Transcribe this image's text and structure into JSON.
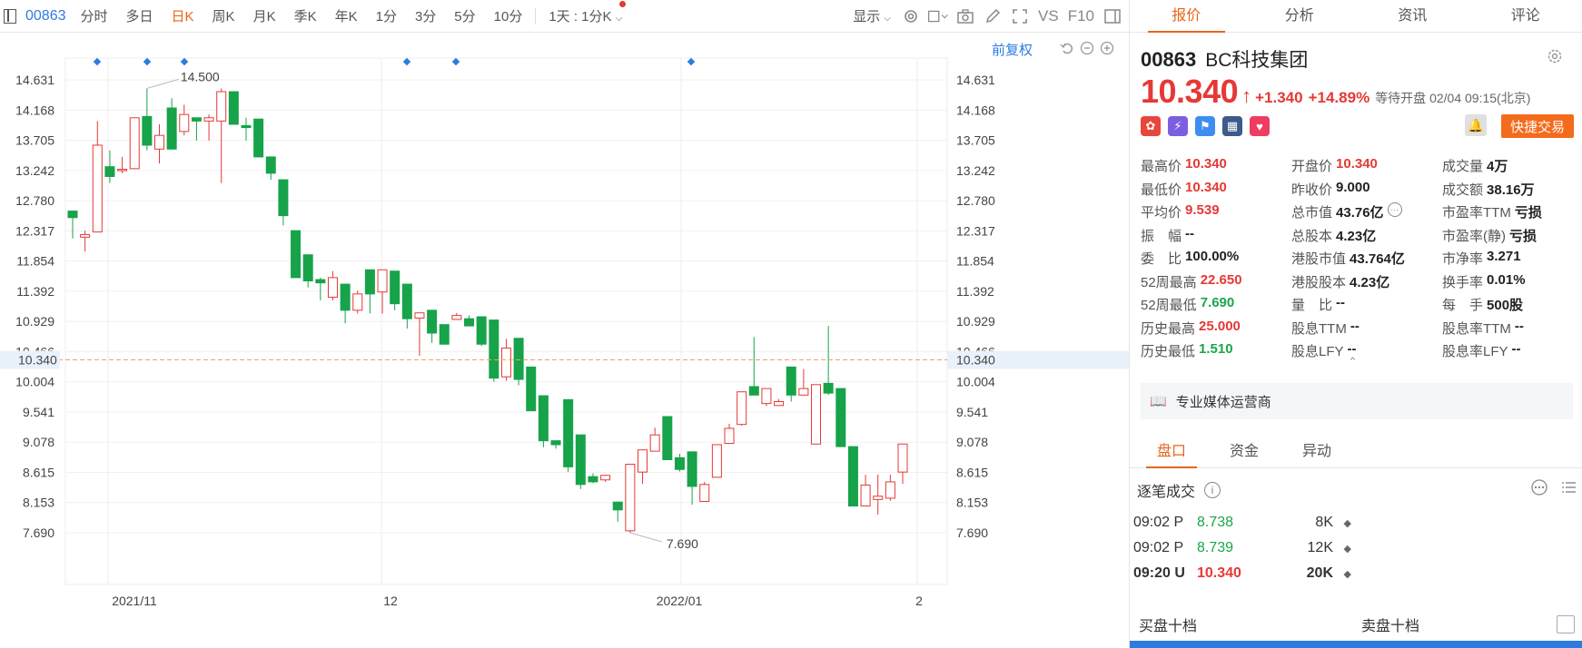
{
  "toolbar": {
    "code": "00863",
    "periods": [
      "分时",
      "多日",
      "日K",
      "周K",
      "月K",
      "季K",
      "年K",
      "1分",
      "3分",
      "5分",
      "10分"
    ],
    "active_period": "日K",
    "multi_period": "1天 : 1分K",
    "display": "显示",
    "vs": "VS",
    "f10": "F10"
  },
  "chart": {
    "adjust": "前复权",
    "high_mark": "14.500",
    "low_mark": "7.690",
    "current_price_label": "10.340",
    "y_ticks": [
      "14.631",
      "14.168",
      "13.705",
      "13.242",
      "12.780",
      "12.317",
      "11.854",
      "11.392",
      "10.929",
      "10.466",
      "10.004",
      "9.541",
      "9.078",
      "8.615",
      "8.153",
      "7.690"
    ],
    "x_labels": [
      "2021/11",
      "12",
      "2022/01",
      "2"
    ]
  },
  "chart_data": {
    "type": "candlestick",
    "ylim": [
      7.69,
      14.631
    ],
    "x": [
      "2021/11",
      "12",
      "2022/01",
      "2"
    ],
    "current_price": 10.34,
    "annotated_high": 14.5,
    "annotated_low": 7.69,
    "candles": [
      {
        "o": 12.62,
        "c": 12.52,
        "h": 12.62,
        "l": 12.2
      },
      {
        "o": 12.22,
        "c": 12.26,
        "h": 12.32,
        "l": 12.0
      },
      {
        "o": 12.3,
        "c": 13.63,
        "h": 14.0,
        "l": 12.3
      },
      {
        "o": 13.3,
        "c": 13.15,
        "h": 13.55,
        "l": 13.05
      },
      {
        "o": 13.26,
        "c": 13.26,
        "h": 13.45,
        "l": 13.2
      },
      {
        "o": 13.27,
        "c": 14.05,
        "h": 14.05,
        "l": 13.27
      },
      {
        "o": 14.07,
        "c": 13.63,
        "h": 14.5,
        "l": 13.55
      },
      {
        "o": 13.57,
        "c": 13.78,
        "h": 13.95,
        "l": 13.35
      },
      {
        "o": 14.2,
        "c": 13.57,
        "h": 14.35,
        "l": 13.57
      },
      {
        "o": 13.84,
        "c": 14.1,
        "h": 14.25,
        "l": 13.78
      },
      {
        "o": 14.05,
        "c": 14.0,
        "h": 14.05,
        "l": 13.7
      },
      {
        "o": 14.0,
        "c": 14.05,
        "h": 14.1,
        "l": 13.7
      },
      {
        "o": 14.0,
        "c": 14.45,
        "h": 14.5,
        "l": 13.05
      },
      {
        "o": 14.45,
        "c": 13.95,
        "h": 14.45,
        "l": 13.95
      },
      {
        "o": 13.93,
        "c": 13.9,
        "h": 14.05,
        "l": 13.7
      },
      {
        "o": 14.03,
        "c": 13.45,
        "h": 14.03,
        "l": 13.45
      },
      {
        "o": 13.45,
        "c": 13.2,
        "h": 13.45,
        "l": 13.1
      },
      {
        "o": 13.1,
        "c": 12.55,
        "h": 13.1,
        "l": 12.4
      },
      {
        "o": 12.32,
        "c": 11.6,
        "h": 12.32,
        "l": 11.6
      },
      {
        "o": 11.95,
        "c": 11.55,
        "h": 11.95,
        "l": 11.45
      },
      {
        "o": 11.57,
        "c": 11.52,
        "h": 11.6,
        "l": 11.25
      },
      {
        "o": 11.3,
        "c": 11.6,
        "h": 11.7,
        "l": 11.25
      },
      {
        "o": 11.5,
        "c": 11.1,
        "h": 11.5,
        "l": 10.9
      },
      {
        "o": 11.1,
        "c": 11.35,
        "h": 11.4,
        "l": 11.05
      },
      {
        "o": 11.72,
        "c": 11.35,
        "h": 11.72,
        "l": 11.05
      },
      {
        "o": 11.38,
        "c": 11.72,
        "h": 11.72,
        "l": 11.05
      },
      {
        "o": 11.7,
        "c": 11.2,
        "h": 11.7,
        "l": 11.1
      },
      {
        "o": 11.5,
        "c": 10.97,
        "h": 11.5,
        "l": 10.82
      },
      {
        "o": 10.98,
        "c": 11.06,
        "h": 11.06,
        "l": 10.4
      },
      {
        "o": 11.1,
        "c": 10.75,
        "h": 11.1,
        "l": 10.6
      },
      {
        "o": 10.88,
        "c": 10.58,
        "h": 10.88,
        "l": 10.58
      },
      {
        "o": 10.96,
        "c": 11.02,
        "h": 11.06,
        "l": 10.96
      },
      {
        "o": 10.97,
        "c": 10.86,
        "h": 11.02,
        "l": 10.86
      },
      {
        "o": 11.0,
        "c": 10.58,
        "h": 11.0,
        "l": 10.55
      },
      {
        "o": 10.95,
        "c": 10.06,
        "h": 10.95,
        "l": 10.0
      },
      {
        "o": 10.08,
        "c": 10.52,
        "h": 10.66,
        "l": 10.02
      },
      {
        "o": 10.67,
        "c": 10.04,
        "h": 10.67,
        "l": 9.95
      },
      {
        "o": 10.23,
        "c": 9.56,
        "h": 10.23,
        "l": 9.56
      },
      {
        "o": 9.79,
        "c": 9.1,
        "h": 9.79,
        "l": 9.0
      },
      {
        "o": 9.1,
        "c": 9.04,
        "h": 9.1,
        "l": 8.98
      },
      {
        "o": 9.73,
        "c": 8.7,
        "h": 9.73,
        "l": 8.62
      },
      {
        "o": 9.19,
        "c": 8.43,
        "h": 9.19,
        "l": 8.36
      },
      {
        "o": 8.55,
        "c": 8.47,
        "h": 8.6,
        "l": 8.45
      },
      {
        "o": 8.5,
        "c": 8.57,
        "h": 8.58,
        "l": 8.47
      },
      {
        "o": 8.16,
        "c": 8.04,
        "h": 8.16,
        "l": 7.86
      },
      {
        "o": 7.72,
        "c": 8.74,
        "h": 8.74,
        "l": 7.69
      },
      {
        "o": 8.62,
        "c": 8.96,
        "h": 8.96,
        "l": 8.44
      },
      {
        "o": 8.94,
        "c": 9.19,
        "h": 9.3,
        "l": 8.94
      },
      {
        "o": 9.47,
        "c": 8.81,
        "h": 9.47,
        "l": 8.81
      },
      {
        "o": 8.84,
        "c": 8.66,
        "h": 8.9,
        "l": 8.63
      },
      {
        "o": 8.93,
        "c": 8.4,
        "h": 8.93,
        "l": 8.12
      },
      {
        "o": 8.17,
        "c": 8.43,
        "h": 8.47,
        "l": 8.17
      },
      {
        "o": 8.54,
        "c": 9.04,
        "h": 9.04,
        "l": 8.54
      },
      {
        "o": 9.06,
        "c": 9.29,
        "h": 9.36,
        "l": 9.06
      },
      {
        "o": 9.35,
        "c": 9.85,
        "h": 9.85,
        "l": 9.33
      },
      {
        "o": 9.93,
        "c": 9.8,
        "h": 10.69,
        "l": 9.8
      },
      {
        "o": 9.67,
        "c": 9.9,
        "h": 9.9,
        "l": 9.63
      },
      {
        "o": 9.64,
        "c": 9.7,
        "h": 9.74,
        "l": 9.64
      },
      {
        "o": 10.23,
        "c": 9.8,
        "h": 10.23,
        "l": 9.7
      },
      {
        "o": 9.8,
        "c": 9.9,
        "h": 10.2,
        "l": 9.8
      },
      {
        "o": 9.05,
        "c": 9.96,
        "h": 9.96,
        "l": 9.05
      },
      {
        "o": 9.98,
        "c": 9.83,
        "h": 10.86,
        "l": 9.8
      },
      {
        "o": 9.9,
        "c": 9.01,
        "h": 9.9,
        "l": 9.01
      },
      {
        "o": 9.01,
        "c": 8.1,
        "h": 9.01,
        "l": 8.1
      },
      {
        "o": 8.1,
        "c": 8.42,
        "h": 8.58,
        "l": 8.1
      },
      {
        "o": 8.2,
        "c": 8.25,
        "h": 8.58,
        "l": 7.97
      },
      {
        "o": 8.22,
        "c": 8.47,
        "h": 8.58,
        "l": 8.18
      },
      {
        "o": 8.62,
        "c": 9.05,
        "h": 9.05,
        "l": 8.44
      }
    ]
  },
  "panel": {
    "tabs": [
      "报价",
      "分析",
      "资讯",
      "评论"
    ],
    "code": "00863",
    "name": "BC科技集团",
    "price": "10.340",
    "change": "+1.340",
    "change_pct": "+14.89%",
    "status": "等待开盘 02/04 09:15(北京)",
    "quick_trade": "快捷交易",
    "quote_rows": [
      [
        {
          "l": "最高价",
          "v": "10.340",
          "c": "red"
        },
        {
          "l": "开盘价",
          "v": "10.340",
          "c": "red"
        },
        {
          "l": "成交量",
          "v": "4万",
          "c": "dark"
        }
      ],
      [
        {
          "l": "最低价",
          "v": "10.340",
          "c": "red"
        },
        {
          "l": "昨收价",
          "v": "9.000",
          "c": "dark"
        },
        {
          "l": "成交额",
          "v": "38.16万",
          "c": "dark"
        }
      ],
      [
        {
          "l": "平均价",
          "v": "9.539",
          "c": "red"
        },
        {
          "l": "总市值",
          "v": "43.76亿",
          "c": "dark"
        },
        {
          "l": "市盈率TTM",
          "v": "亏损",
          "c": "dark"
        }
      ],
      [
        {
          "l": "振　幅",
          "v": "--",
          "c": "dark"
        },
        {
          "l": "总股本",
          "v": "4.23亿",
          "c": "dark"
        },
        {
          "l": "市盈率(静)",
          "v": "亏损",
          "c": "dark"
        }
      ],
      [
        {
          "l": "委　比",
          "v": "100.00%",
          "c": "dark"
        },
        {
          "l": "港股市值",
          "v": "43.764亿",
          "c": "dark"
        },
        {
          "l": "市净率",
          "v": "3.271",
          "c": "dark"
        }
      ],
      [
        {
          "l": "52周最高",
          "v": "22.650",
          "c": "red"
        },
        {
          "l": "港股股本",
          "v": "4.23亿",
          "c": "dark"
        },
        {
          "l": "换手率",
          "v": "0.01%",
          "c": "dark"
        }
      ],
      [
        {
          "l": "52周最低",
          "v": "7.690",
          "c": "green"
        },
        {
          "l": "量　比",
          "v": "--",
          "c": "dark"
        },
        {
          "l": "每　手",
          "v": "500股",
          "c": "dark"
        }
      ],
      [
        {
          "l": "历史最高",
          "v": "25.000",
          "c": "red"
        },
        {
          "l": "股息TTM",
          "v": "--",
          "c": "dark"
        },
        {
          "l": "股息率TTM",
          "v": "--",
          "c": "dark"
        }
      ],
      [
        {
          "l": "历史最低",
          "v": "1.510",
          "c": "green"
        },
        {
          "l": "股息LFY",
          "v": "--",
          "c": "dark"
        },
        {
          "l": "股息率LFY",
          "v": "--",
          "c": "dark"
        }
      ]
    ],
    "industry": "专业媒体运营商",
    "subtabs": [
      "盘口",
      "资金",
      "异动"
    ],
    "ticks_title": "逐笔成交",
    "ticks": [
      {
        "time": "09:02 P",
        "price": "8.738",
        "vol": "8K",
        "color": "green",
        "bold": false
      },
      {
        "time": "09:02 P",
        "price": "8.739",
        "vol": "12K",
        "color": "green",
        "bold": false
      },
      {
        "time": "09:20 U",
        "price": "10.340",
        "vol": "20K",
        "color": "red",
        "bold": true
      }
    ],
    "buy_book": "买盘十档",
    "sell_book": "卖盘十档"
  },
  "colors": {
    "up": "#e53935",
    "down": "#17a34a",
    "accent": "#e8651a",
    "link": "#2e7be0"
  }
}
